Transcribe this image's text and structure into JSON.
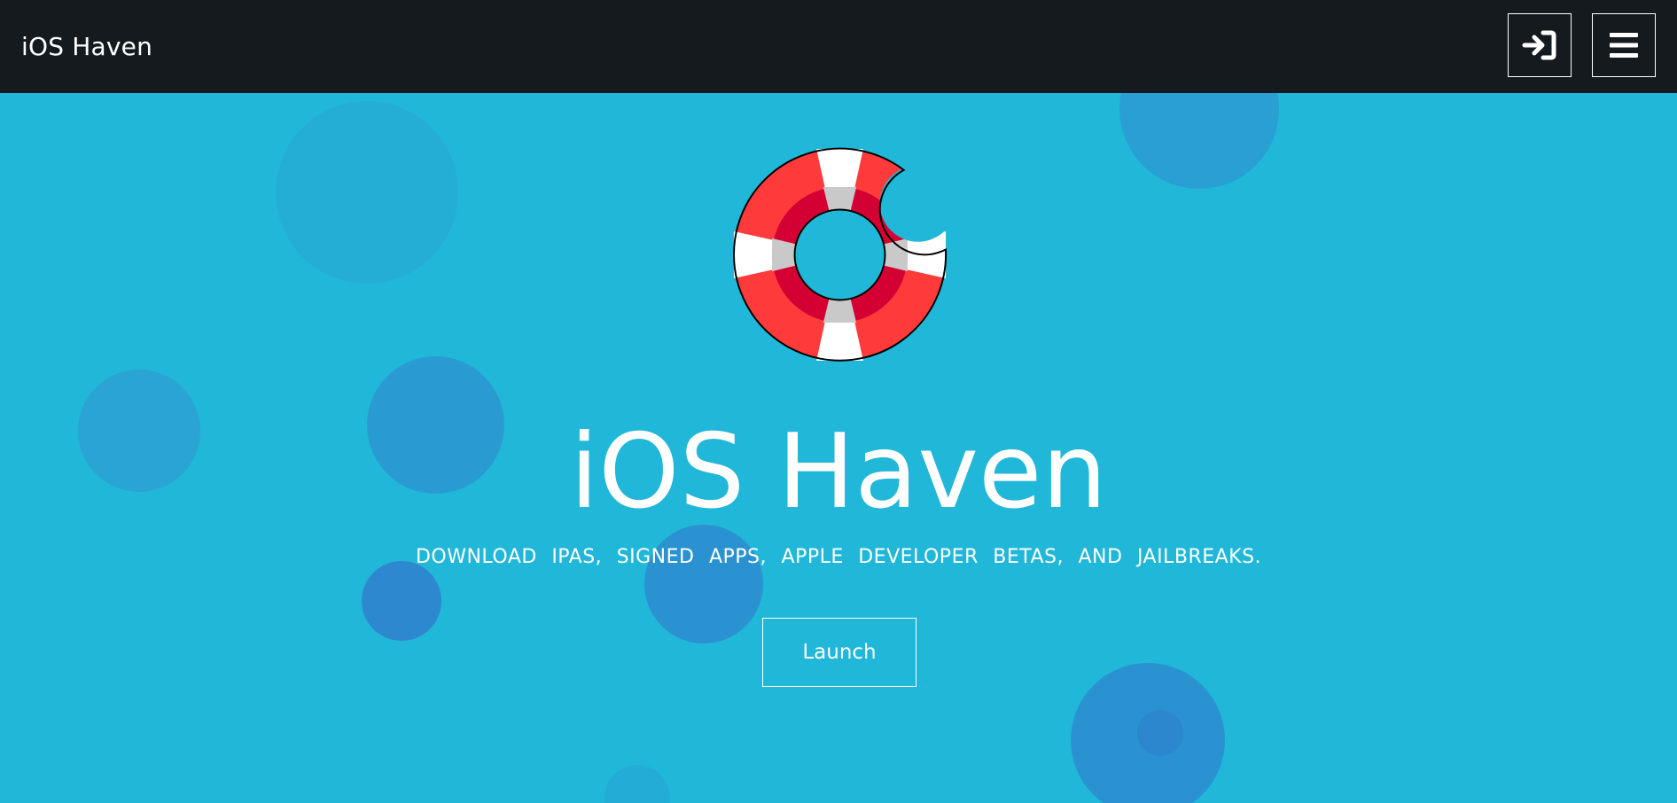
{
  "navbar": {
    "brand": "iOS Haven",
    "login_icon": "sign-in-icon",
    "menu_icon": "hamburger-menu-icon"
  },
  "hero": {
    "logo_icon": "bitten-life-ring-icon",
    "title": "iOS Haven",
    "subtitle": "DOWNLOAD IPAS, SIGNED APPS, APPLE DEVELOPER BETAS, AND JAILBREAKS.",
    "launch_label": "Launch"
  },
  "colors": {
    "navbar_bg": "#151a1f",
    "hero_bg": "#21b7d8",
    "bubble_light": "#24aed6",
    "bubble_mid": "#2a9bd2",
    "bubble_dark": "#2d88cf",
    "ring_red": "#ff3a3a",
    "ring_dark_red": "#d40033",
    "ring_white": "#ffffff",
    "ring_gray": "#c9c9c9"
  }
}
